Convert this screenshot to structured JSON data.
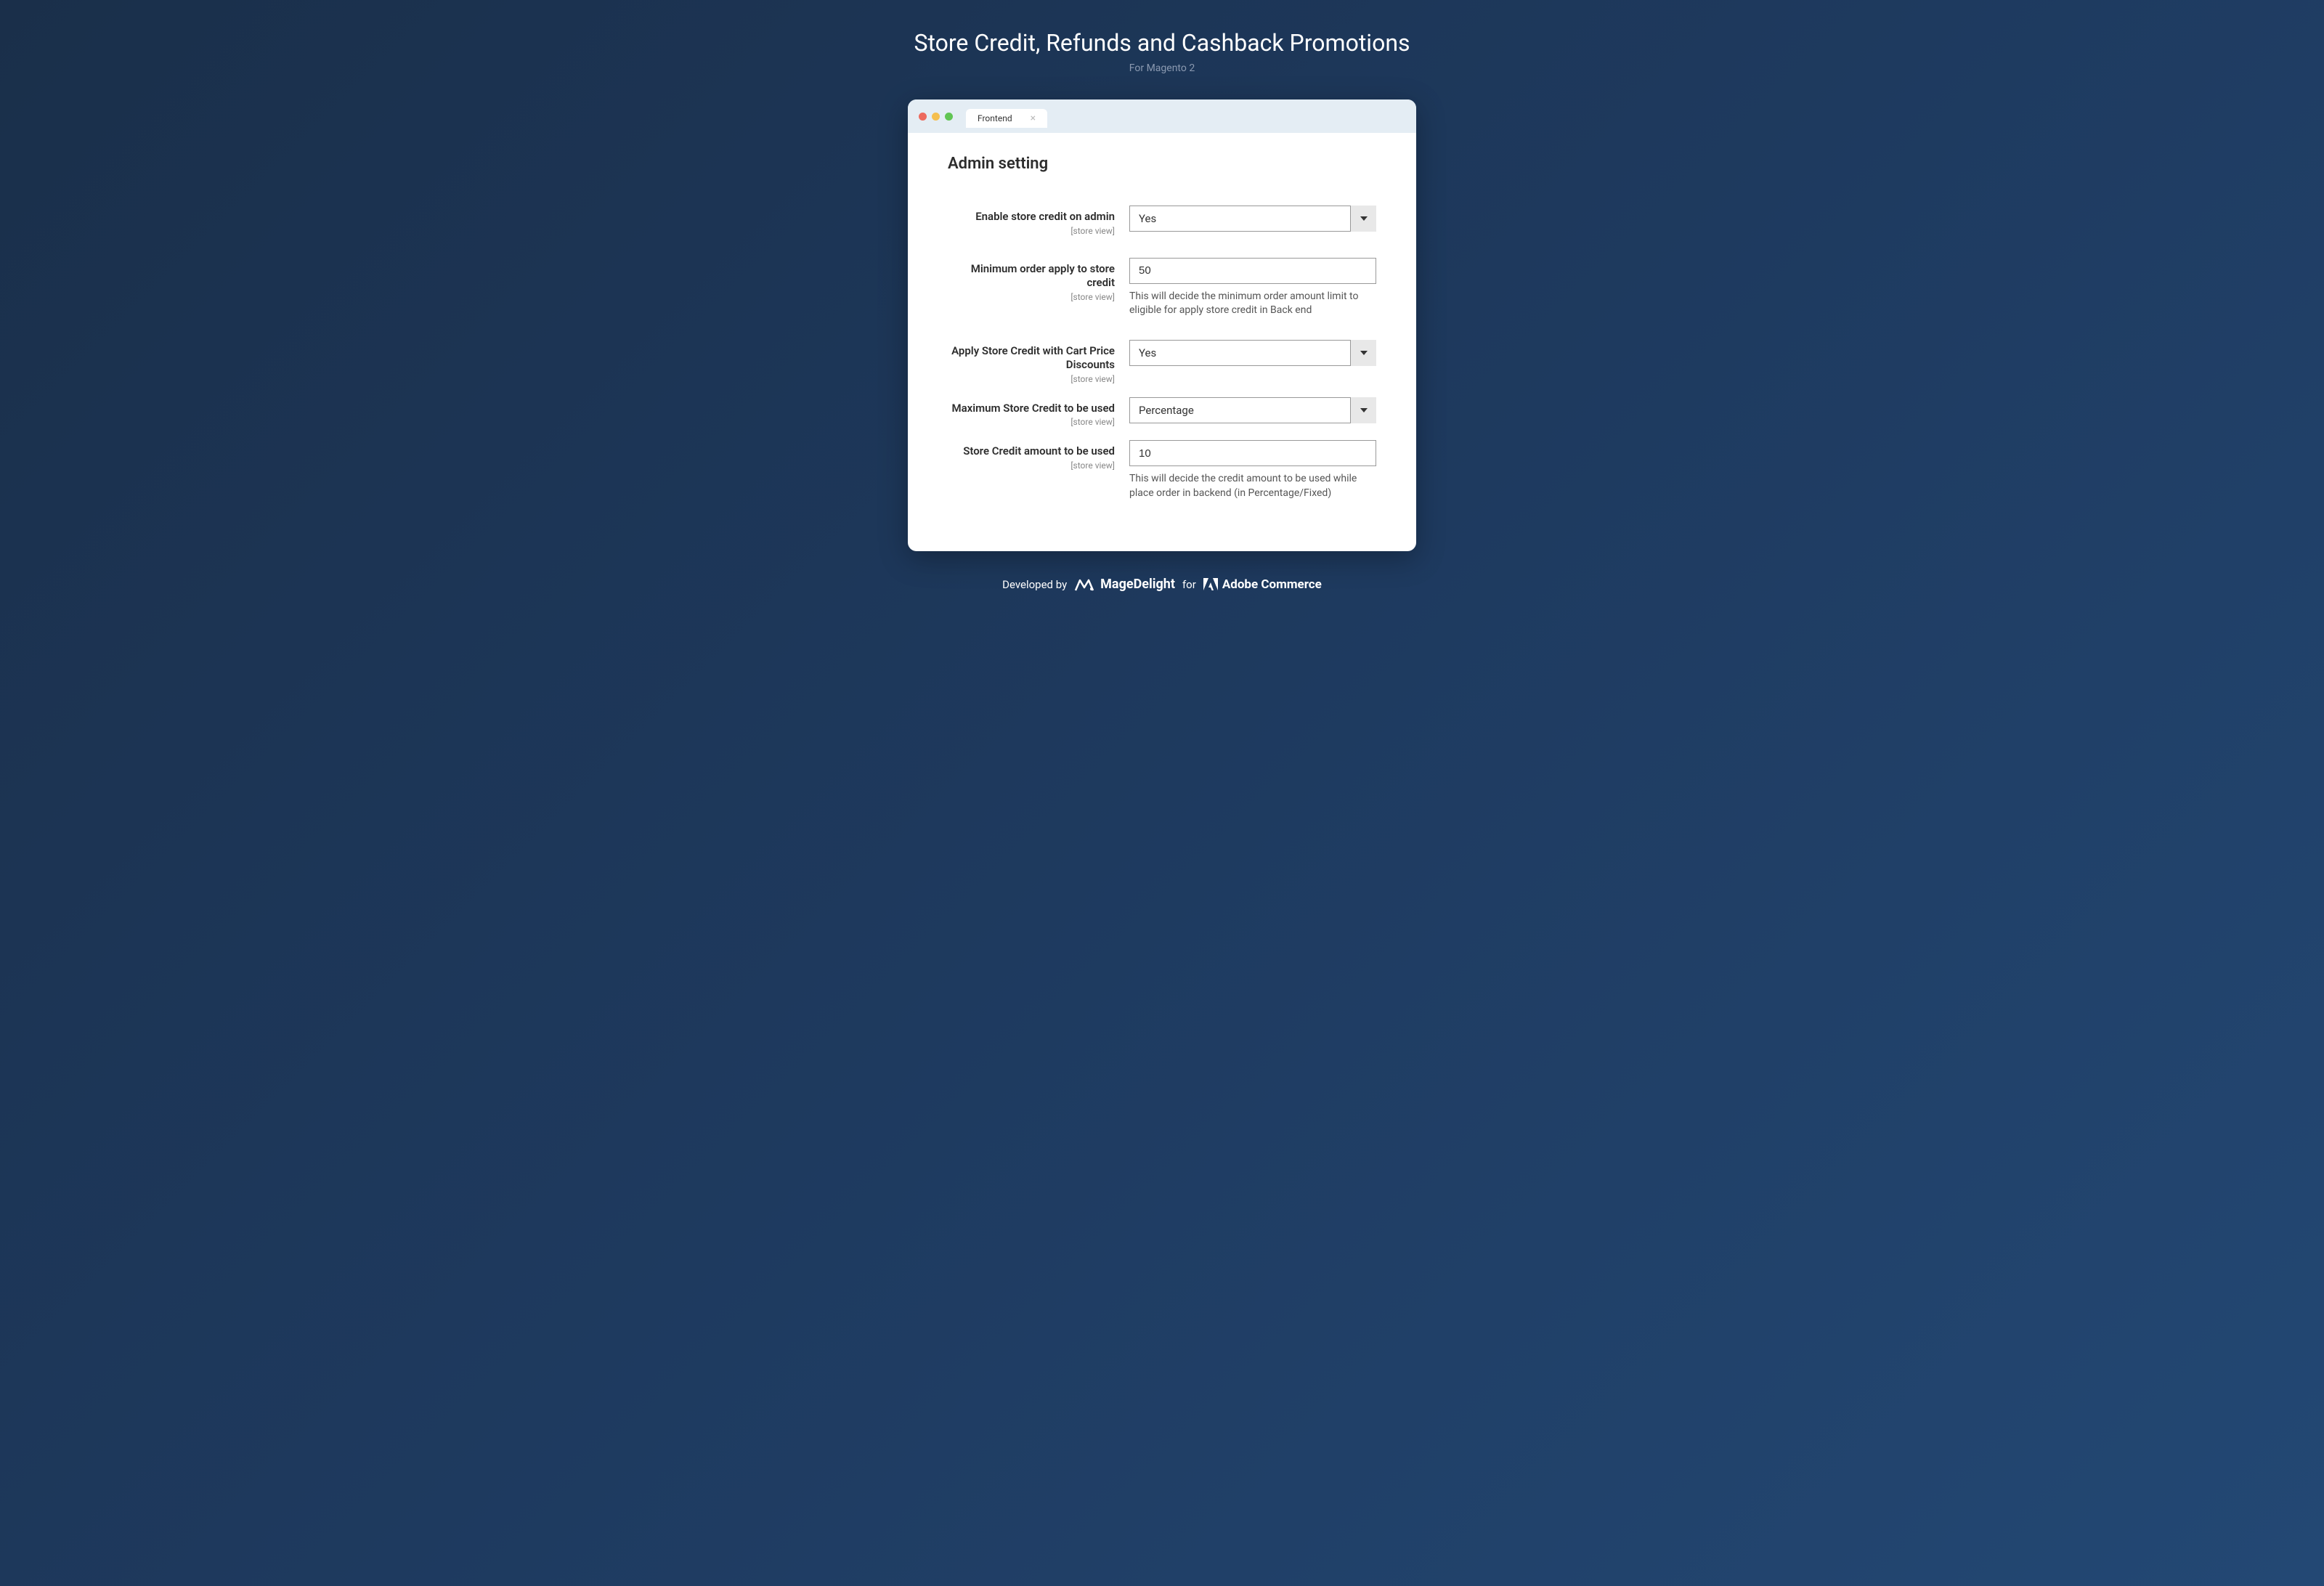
{
  "header": {
    "title": "Store Credit, Refunds and Cashback Promotions",
    "subtitle": "For Magento 2"
  },
  "browser": {
    "tab_label": "Frontend"
  },
  "section": {
    "heading": "Admin setting"
  },
  "fields": {
    "enable_store_credit": {
      "label": "Enable store credit on admin",
      "scope": "[store view]",
      "value": "Yes"
    },
    "minimum_order": {
      "label": "Minimum order apply to store credit",
      "scope": "[store view]",
      "value": "50",
      "help": "This will decide the minimum order amount limit to eligible for apply store credit in Back end"
    },
    "apply_with_cart": {
      "label": "Apply Store Credit with Cart Price Discounts",
      "scope": "[store view]",
      "value": "Yes"
    },
    "max_store_credit": {
      "label": "Maximum Store Credit to be used",
      "scope": "[store view]",
      "value": "Percentage"
    },
    "credit_amount": {
      "label": "Store Credit amount to be used",
      "scope": "[store view]",
      "value": "10",
      "help": "This will decide the credit amount to be used while place order in backend (in Percentage/Fixed)"
    }
  },
  "footer": {
    "developed_by": "Developed by",
    "brand1": "MageDelight",
    "for": "for",
    "brand2": "Adobe Commerce"
  }
}
